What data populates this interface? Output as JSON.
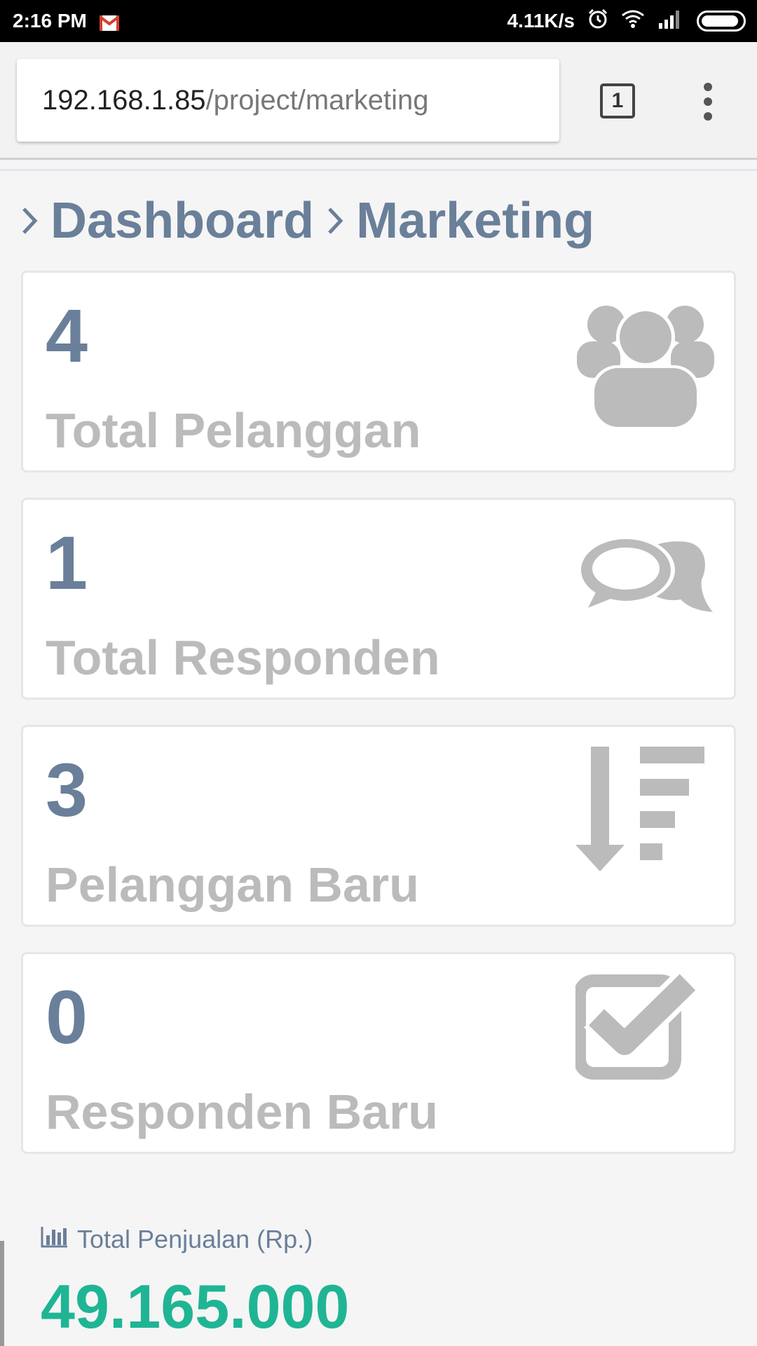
{
  "status_bar": {
    "time": "2:16 PM",
    "net_speed": "4.11K/s",
    "icons": [
      "gmail-icon",
      "alarm-icon",
      "wifi-icon",
      "signal-icon",
      "battery-icon"
    ]
  },
  "browser": {
    "url_host": "192.168.1.85",
    "url_path": "/project/marketing",
    "tab_count": "1"
  },
  "breadcrumb": {
    "items": [
      "Dashboard",
      "Marketing"
    ]
  },
  "cards": [
    {
      "value": "4",
      "label": "Total Pelanggan",
      "icon": "users-icon"
    },
    {
      "value": "1",
      "label": "Total Responden",
      "icon": "chat-bubbles-icon"
    },
    {
      "value": "3",
      "label": "Pelanggan Baru",
      "icon": "sort-descending-icon"
    },
    {
      "value": "0",
      "label": "Responden Baru",
      "icon": "checkbox-checked-icon"
    }
  ],
  "sales": {
    "label": "Total Penjualan (Rp.)",
    "value": "49.165.000",
    "icon": "bar-chart-icon"
  },
  "colors": {
    "title": "#6a7f99",
    "muted": "#bbbbbb",
    "accent": "#1fb594",
    "icon_gray": "#bbbbbb"
  }
}
